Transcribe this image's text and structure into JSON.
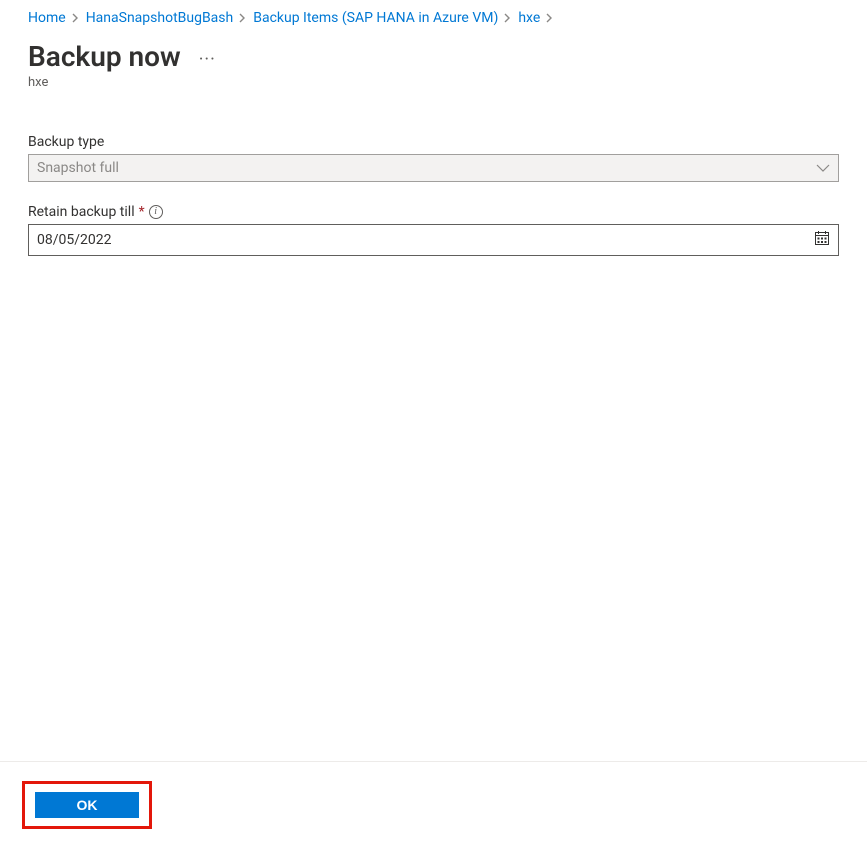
{
  "breadcrumb": {
    "home": "Home",
    "vault": "HanaSnapshotBugBash",
    "items": "Backup Items (SAP HANA in Azure VM)",
    "instance": "hxe"
  },
  "header": {
    "title": "Backup now",
    "subtitle": "hxe",
    "more_aria": "More options"
  },
  "form": {
    "backup_type_label": "Backup type",
    "backup_type_value": "Snapshot full",
    "retain_label": "Retain backup till",
    "retain_value": "08/05/2022"
  },
  "footer": {
    "ok_label": "OK"
  }
}
